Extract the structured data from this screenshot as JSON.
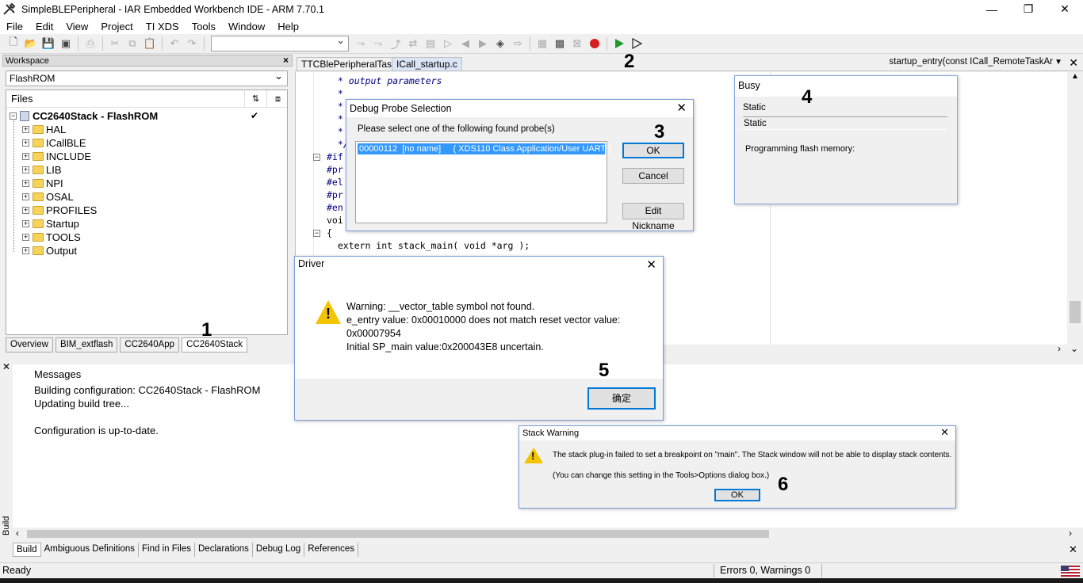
{
  "window": {
    "title": "SimpleBLEPeripheral - IAR Embedded Workbench IDE - ARM 7.70.1",
    "minimize": "—",
    "restore": "❐",
    "close": "✕"
  },
  "menu": [
    "File",
    "Edit",
    "View",
    "Project",
    "TI XDS",
    "Tools",
    "Window",
    "Help"
  ],
  "workspace": {
    "title": "Workspace",
    "close": "×",
    "config": "FlashROM",
    "files_header": "Files",
    "project": "CC2640Stack - FlashROM",
    "checkmark": "✔",
    "folders": [
      "HAL",
      "ICallBLE",
      "INCLUDE",
      "LIB",
      "NPI",
      "OSAL",
      "PROFILES",
      "Startup",
      "TOOLS",
      "Output"
    ],
    "tabs": [
      "Overview",
      "BIM_extflash",
      "CC2640App",
      "CC2640Stack"
    ]
  },
  "editor": {
    "tabs": [
      "TTCBlePeripheralTask.c",
      "ICall_startup.c"
    ],
    "function": "startup_entry(const ICall_RemoteTaskAr",
    "lines": [
      " * output parameters",
      " *",
      " *",
      " * ",
      " * ",
      " */",
      "#if",
      "#pr",
      "#el",
      "#pr",
      "#en",
      "voi",
      "{",
      "  extern int stack_main( void *arg );"
    ]
  },
  "messages": {
    "header": "Messages",
    "lines": [
      "Building configuration: CC2640Stack - FlashROM",
      "Updating build tree...",
      "",
      "Configuration is up-to-date."
    ],
    "tabs": [
      "Build",
      "Ambiguous Definitions",
      "Find in Files",
      "Declarations",
      "Debug Log",
      "References"
    ],
    "side_label": "Build",
    "close": "✕"
  },
  "status": {
    "left": "Ready",
    "right": "Errors 0, Warnings 0"
  },
  "probe_dialog": {
    "title": "Debug Probe Selection",
    "prompt": "Please select one of the following found probe(s)",
    "item": "00000112  [no name]     ( XDS110 Class Application/User UART )",
    "ok": "OK",
    "cancel": "Cancel",
    "nickname": "Edit Nickname",
    "close": "✕"
  },
  "busy_dialog": {
    "title": "Busy",
    "label1": "Static",
    "label2": "Static",
    "status": "Programming flash memory:"
  },
  "driver_dialog": {
    "title": "Driver",
    "close": "✕",
    "lines": [
      "Warning: __vector_table symbol not found.",
      "e_entry value: 0x00010000 does not match reset vector value:",
      "0x00007954",
      "Initial SP_main value:0x200043E8 uncertain."
    ],
    "ok": "确定"
  },
  "stack_dialog": {
    "title": "Stack Warning",
    "close": "✕",
    "line1": "The stack plug-in failed to set a breakpoint on \"main\". The Stack window will not be able to display stack contents.",
    "line2": "(You can change this setting in the Tools>Options dialog box.)",
    "ok": "OK"
  },
  "annotations": [
    "1",
    "2",
    "3",
    "4",
    "5",
    "6"
  ]
}
